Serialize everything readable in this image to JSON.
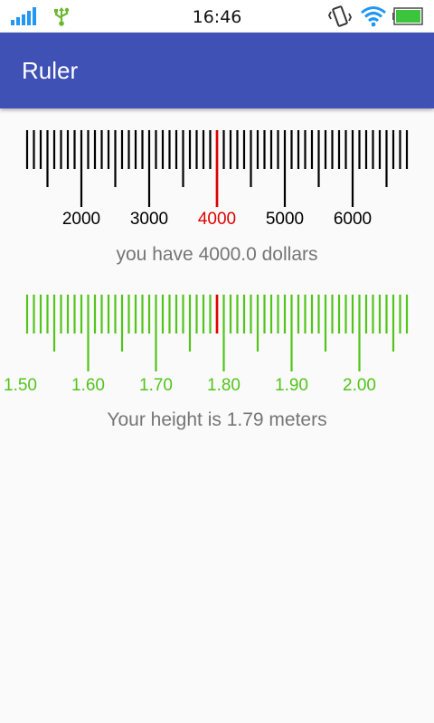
{
  "status_bar": {
    "time": "16:46",
    "icons": [
      "signal-icon",
      "usb-icon",
      "vibrate-icon",
      "wifi-icon",
      "battery-icon"
    ],
    "signal_color": "#2196f3",
    "usb_color": "#6bb72e",
    "battery_color": "#3cc43c"
  },
  "app_bar": {
    "title": "Ruler",
    "color": "#3f51b5"
  },
  "money_ruler": {
    "labels": [
      "2000",
      "3000",
      "4000",
      "5000",
      "6000"
    ],
    "selected_value": 4000,
    "selected_label": "4000",
    "major_step": 1000,
    "minor_step": 100,
    "tick_color": "#000000",
    "indicator_color": "#e00000",
    "caption": "you have 4000.0 dollars"
  },
  "height_ruler": {
    "labels": [
      "1.50",
      "1.60",
      "1.70",
      "1.80",
      "1.90",
      "2.00"
    ],
    "selected_value": 1.79,
    "major_step": 0.1,
    "minor_step": 0.01,
    "tick_color": "#52c41a",
    "indicator_color": "#e00000",
    "caption": "Your height is 1.79 meters"
  }
}
